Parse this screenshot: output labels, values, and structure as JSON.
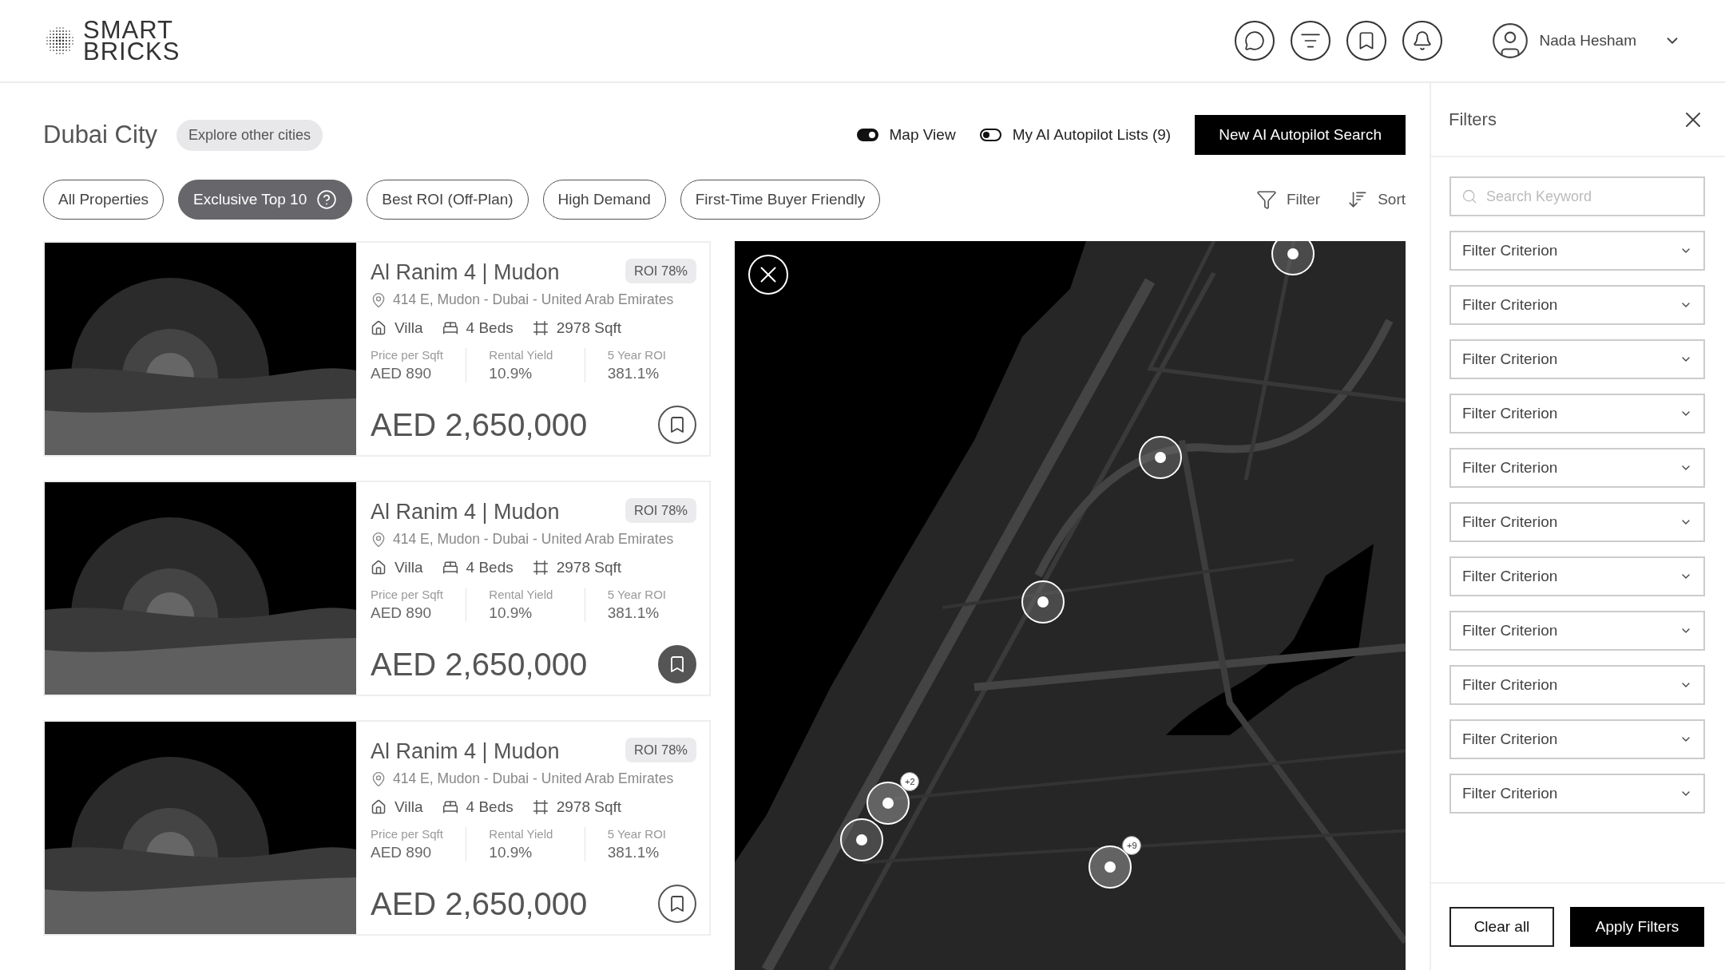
{
  "logo": {
    "lines": [
      "SMART",
      "BRICKS"
    ]
  },
  "header": {
    "user_name": "Nada Hesham"
  },
  "city": {
    "title": "Dubai City",
    "explore": "Explore other cities"
  },
  "toggles": [
    {
      "label": "Map View",
      "on": true
    },
    {
      "label": "My AI Autopilot Lists (9)",
      "on": false
    }
  ],
  "primary_button": "New AI Autopilot Search",
  "chips": [
    {
      "label": "All Properties",
      "selected": false,
      "kind": "plain"
    },
    {
      "label": "Exclusive Top 10",
      "selected": true,
      "kind": "help"
    },
    {
      "label": "Best ROI (Off-Plan)",
      "selected": false,
      "kind": "plain"
    },
    {
      "label": "High Demand",
      "selected": false,
      "kind": "plain"
    },
    {
      "label": "First-Time Buyer Friendly",
      "selected": false,
      "kind": "plain"
    }
  ],
  "tools": {
    "filter": "Filter",
    "sort": "Sort"
  },
  "properties": [
    {
      "title": "Al Ranim 4 | Mudon",
      "roi": "ROI 78%",
      "address": "414 E, Mudon - Dubai - United Arab Emirates",
      "type": "Villa",
      "beds": "4 Beds",
      "area": "2978 Sqft",
      "stats": [
        {
          "label": "Price per Sqft",
          "value": "AED 890"
        },
        {
          "label": "Rental Yield",
          "value": "10.9%"
        },
        {
          "label": "5 Year ROI",
          "value": "381.1%"
        }
      ],
      "price": "AED 2,650,000",
      "saved": false
    },
    {
      "title": "Al Ranim 4 | Mudon",
      "roi": "ROI 78%",
      "address": "414 E, Mudon - Dubai - United Arab Emirates",
      "type": "Villa",
      "beds": "4 Beds",
      "area": "2978 Sqft",
      "stats": [
        {
          "label": "Price per Sqft",
          "value": "AED 890"
        },
        {
          "label": "Rental Yield",
          "value": "10.9%"
        },
        {
          "label": "5 Year ROI",
          "value": "381.1%"
        }
      ],
      "price": "AED 2,650,000",
      "saved": true
    },
    {
      "title": "Al Ranim 4 | Mudon",
      "roi": "ROI 78%",
      "address": "414 E, Mudon - Dubai - United Arab Emirates",
      "type": "Villa",
      "beds": "4 Beds",
      "area": "2978 Sqft",
      "stats": [
        {
          "label": "Price per Sqft",
          "value": "AED 890"
        },
        {
          "label": "Rental Yield",
          "value": "10.9%"
        },
        {
          "label": "5 Year ROI",
          "value": "381.1%"
        }
      ],
      "price": "AED 2,650,000",
      "saved": false
    }
  ],
  "map": {
    "markers": [
      {
        "kind": "pin"
      },
      {
        "kind": "pin"
      },
      {
        "kind": "pin"
      },
      {
        "kind": "cluster",
        "badge": "+2"
      },
      {
        "kind": "pin"
      },
      {
        "kind": "cluster",
        "badge": "+9"
      }
    ]
  },
  "filters": {
    "title": "Filters",
    "search_placeholder": "Search Keyword",
    "criteria": [
      "Filter Criterion",
      "Filter Criterion",
      "Filter Criterion",
      "Filter Criterion",
      "Filter Criterion",
      "Filter Criterion",
      "Filter Criterion",
      "Filter Criterion",
      "Filter Criterion",
      "Filter Criterion",
      "Filter Criterion"
    ],
    "clear": "Clear all",
    "apply": "Apply Filters"
  }
}
